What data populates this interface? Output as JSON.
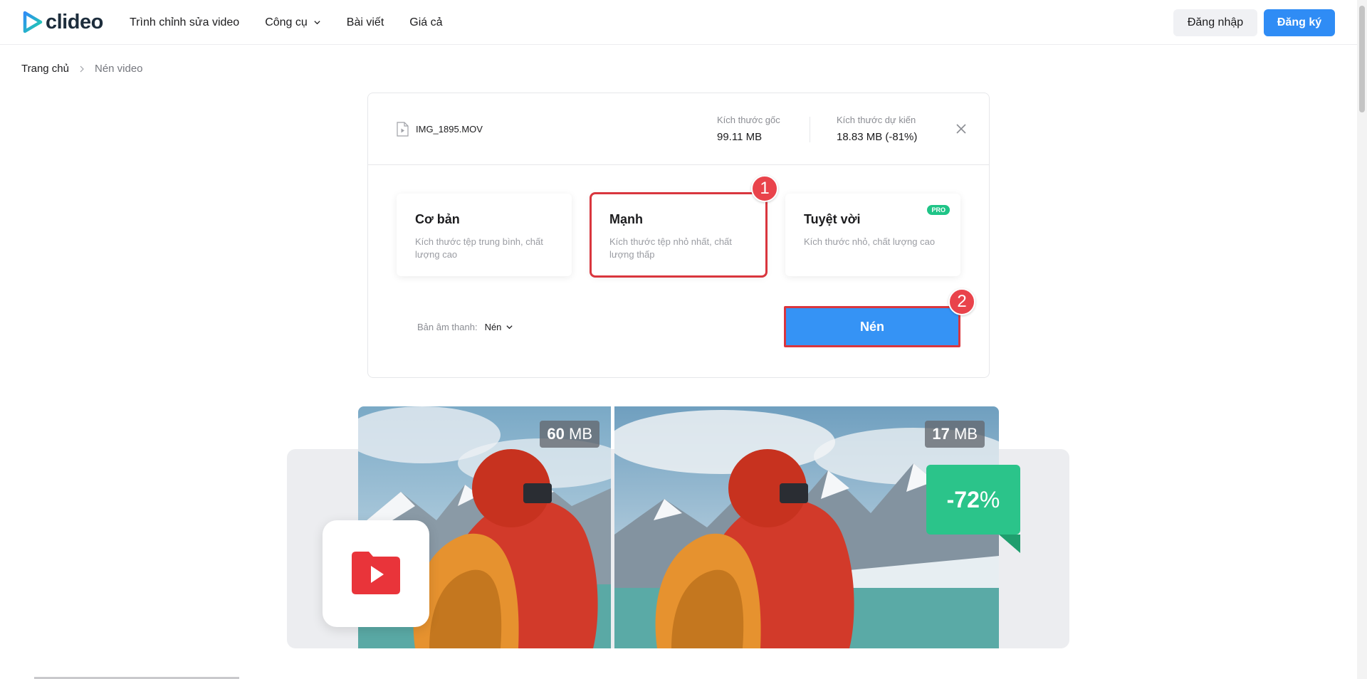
{
  "header": {
    "logo_text": "clideo",
    "nav": [
      {
        "label": "Trình chỉnh sửa video"
      },
      {
        "label": "Công cụ"
      },
      {
        "label": "Bài viết"
      },
      {
        "label": "Giá cả"
      }
    ],
    "login_label": "Đăng nhập",
    "signup_label": "Đăng ký"
  },
  "breadcrumb": {
    "home": "Trang chủ",
    "current": "Nén video"
  },
  "file": {
    "name": "IMG_1895.MOV",
    "original_label": "Kích thước gốc",
    "original_value": "99.11 MB",
    "expected_label": "Kích thước dự kiến",
    "expected_value": "18.83 MB (-81%)"
  },
  "options": [
    {
      "title": "Cơ bản",
      "desc": "Kích thước tệp trung bình, chất lượng cao"
    },
    {
      "title": "Mạnh",
      "desc": "Kích thước tệp nhỏ nhất, chất lượng thấp"
    },
    {
      "title": "Tuyệt vời",
      "desc": "Kích thước nhỏ, chất lượng cao",
      "badge": "PRO"
    }
  ],
  "markers": [
    "1",
    "2"
  ],
  "audio": {
    "label": "Bản âm thanh:",
    "value": "Nén"
  },
  "compress_label": "Nén",
  "illustration": {
    "before_num": "60",
    "before_unit": " MB",
    "after_num": "17",
    "after_unit": " MB",
    "pct_num": "-72",
    "pct_unit": "%"
  },
  "colors": {
    "accent": "#2f8cf5",
    "highlight": "#d9363e",
    "success": "#2bc48a"
  }
}
